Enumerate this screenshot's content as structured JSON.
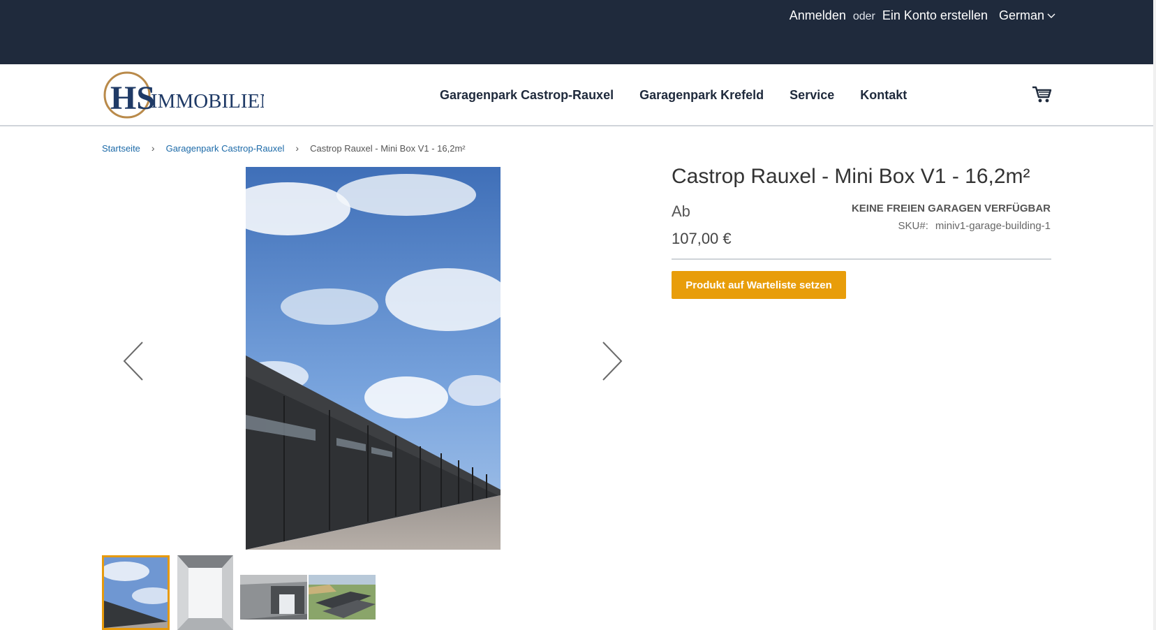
{
  "topbar": {
    "login": "Anmelden",
    "or": "oder",
    "register": "Ein Konto erstellen",
    "language": "German"
  },
  "header": {
    "logo_text": "IMMOBILIEN",
    "logo_mark": "HS",
    "nav": [
      "Garagenpark Castrop-Rauxel",
      "Garagenpark Krefeld",
      "Service",
      "Kontakt"
    ]
  },
  "breadcrumb": {
    "home": "Startseite",
    "category": "Garagenpark Castrop-Rauxel",
    "current": "Castrop Rauxel - Mini Box V1 - 16,2m²"
  },
  "product": {
    "title": "Castrop Rauxel - Mini Box V1 - 16,2m²",
    "price_prefix": "Ab",
    "price": "107,00 €",
    "stock_status": "KEINE FREIEN GARAGEN VERFÜGBAR",
    "sku_label": "SKU#:",
    "sku_value": "miniv1-garage-building-1",
    "waitlist_button": "Produkt auf Warteliste setzen"
  },
  "colors": {
    "topbar_bg": "#1f2a3c",
    "accent": "#e89d0a",
    "link": "#1c6aa8"
  }
}
